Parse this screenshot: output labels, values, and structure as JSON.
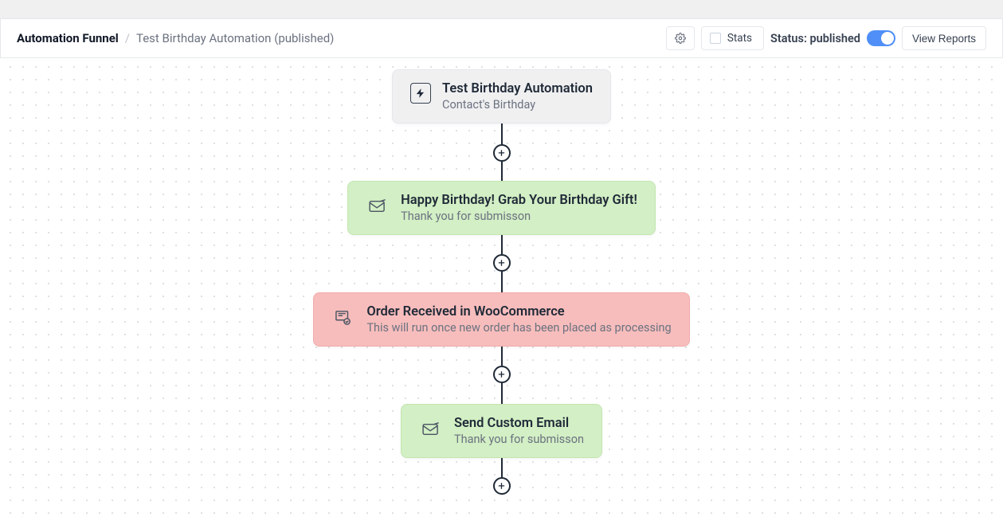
{
  "header": {
    "breadcrumb_root": "Automation Funnel",
    "breadcrumb_sep": "/",
    "breadcrumb_current": "Test Birthday Automation (published)",
    "stats_label": "Stats",
    "status_prefix": "Status: ",
    "status_value": "published",
    "view_reports": "View Reports"
  },
  "nodes": [
    {
      "type": "trigger",
      "title": "Test Birthday Automation",
      "subtitle": "Contact's Birthday",
      "icon": "bolt"
    },
    {
      "type": "action-green",
      "title": "Happy Birthday! Grab Your Birthday Gift!",
      "subtitle": "Thank you for submisson",
      "icon": "mail"
    },
    {
      "type": "action-red",
      "title": "Order Received in WooCommerce",
      "subtitle": "This will run once new order has been placed as processing",
      "icon": "cart"
    },
    {
      "type": "action-green",
      "title": "Send Custom Email",
      "subtitle": "Thank you for submisson",
      "icon": "mail"
    }
  ],
  "plus_label": "+"
}
